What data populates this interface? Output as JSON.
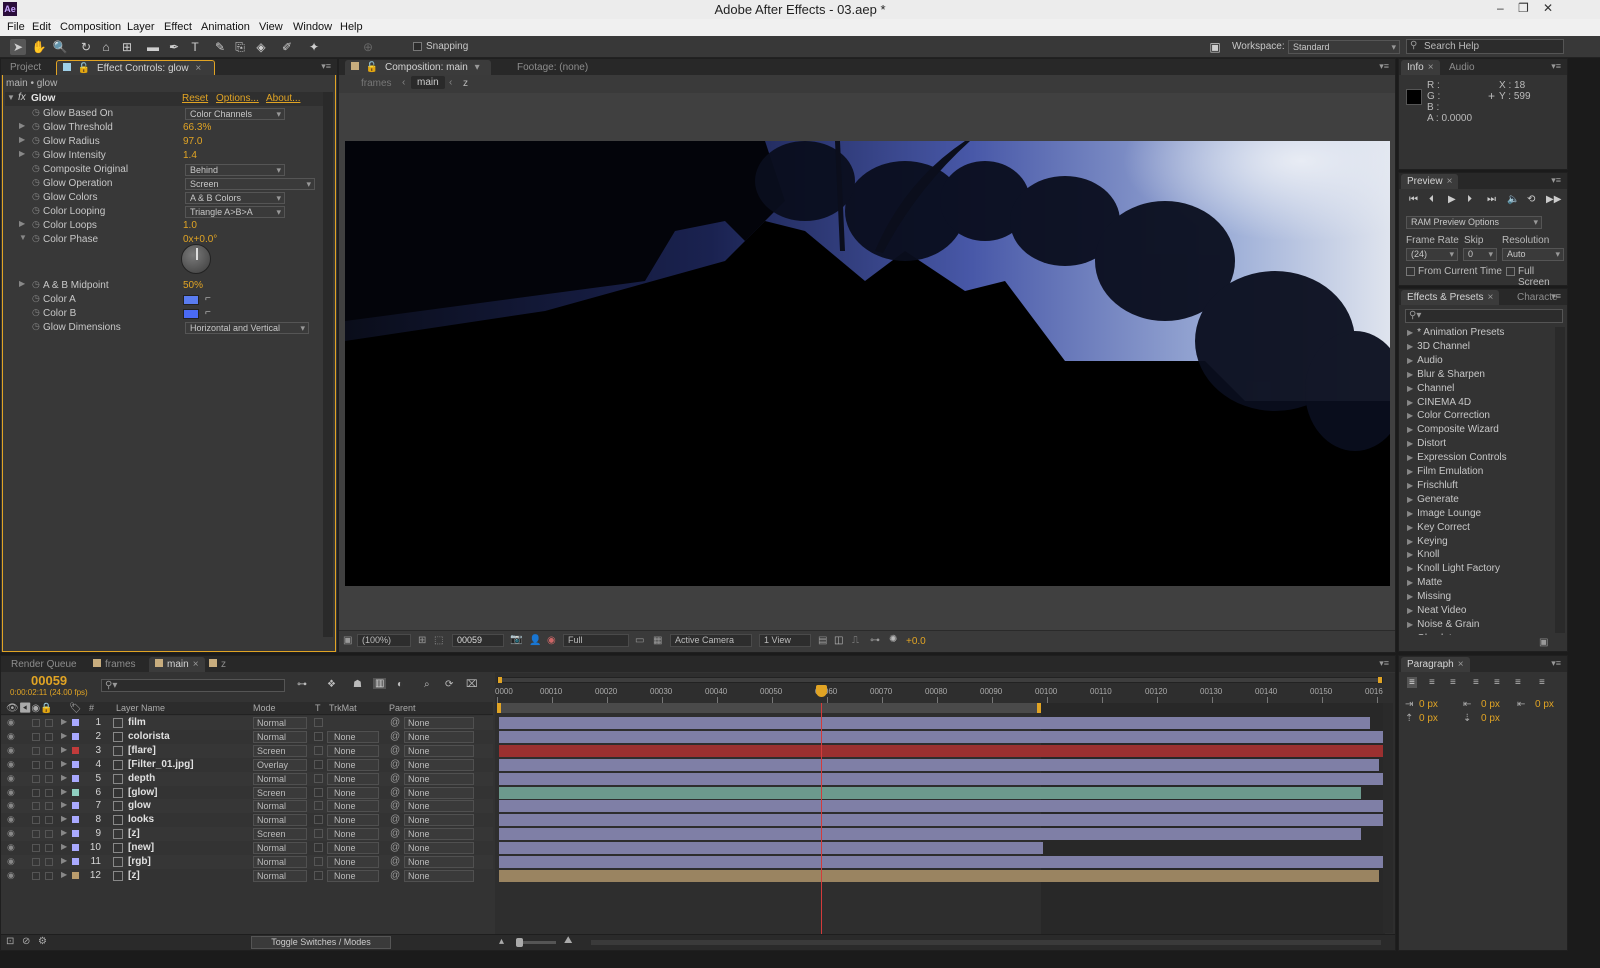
{
  "app": {
    "title": "Adobe After Effects - 03.aep *",
    "logo": "Ae"
  },
  "menu": [
    "File",
    "Edit",
    "Composition",
    "Layer",
    "Effect",
    "Animation",
    "View",
    "Window",
    "Help"
  ],
  "toolbar": {
    "snapping_label": "Snapping",
    "workspace_label": "Workspace:",
    "workspace_value": "Standard",
    "search_placeholder": "Search Help"
  },
  "effect_controls": {
    "tab_project": "Project",
    "tab_label": "Effect Controls: glow",
    "breadcrumb": "main • glow",
    "effect_name": "Glow",
    "links": {
      "reset": "Reset",
      "options": "Options...",
      "about": "About..."
    },
    "props": [
      {
        "label": "Glow Based On",
        "dropdown": "Color Channels"
      },
      {
        "label": "Glow Threshold",
        "value": "66.3%"
      },
      {
        "label": "Glow Radius",
        "value": "97.0"
      },
      {
        "label": "Glow Intensity",
        "value": "1.4"
      },
      {
        "label": "Composite Original",
        "dropdown": "Behind"
      },
      {
        "label": "Glow Operation",
        "dropdown": "Screen"
      },
      {
        "label": "Glow Colors",
        "dropdown": "A & B Colors"
      },
      {
        "label": "Color Looping",
        "dropdown": "Triangle A>B>A"
      },
      {
        "label": "Color Loops",
        "value": "1.0"
      },
      {
        "label": "Color Phase",
        "value": "0x+0.0°"
      },
      {
        "label": "A & B Midpoint",
        "value": "50%"
      },
      {
        "label": "Color A"
      },
      {
        "label": "Color B"
      },
      {
        "label": "Glow Dimensions",
        "dropdown": "Horizontal and Vertical"
      }
    ],
    "color_a": "#5a7cf0",
    "color_b": "#4a6af4"
  },
  "composition": {
    "tab_label": "Composition: main",
    "footage_tab": "Footage: (none)",
    "breadcrumbs": [
      "frames",
      "main",
      "z"
    ],
    "zoom": "(100%)",
    "timecode": "00059",
    "resolution": "Full",
    "camera": "Active Camera",
    "views": "1 View",
    "exposure": "+0.0"
  },
  "info": {
    "tab_info": "Info",
    "tab_audio": "Audio",
    "r": "R :",
    "g": "G :",
    "b": "B :",
    "a": "A :  0.0000",
    "x": "X : 18",
    "y": "Y : 599"
  },
  "preview": {
    "tab_label": "Preview",
    "ram_options": "RAM Preview Options",
    "frame_rate_label": "Frame Rate",
    "skip_label": "Skip",
    "resolution_label": "Resolution",
    "frame_rate": "(24)",
    "skip": "0",
    "resolution": "Auto",
    "from_current": "From Current Time",
    "full_screen": "Full Screen"
  },
  "effects_presets": {
    "tab_label": "Effects & Presets",
    "tab_character": "Characte",
    "items": [
      "* Animation Presets",
      "3D Channel",
      "Audio",
      "Blur & Sharpen",
      "Channel",
      "CINEMA 4D",
      "Color Correction",
      "Composite Wizard",
      "Distort",
      "Expression Controls",
      "Film Emulation",
      "Frischluft",
      "Generate",
      "Image Lounge",
      "Key Correct",
      "Keying",
      "Knoll",
      "Knoll Light Factory",
      "Matte",
      "Missing",
      "Neat Video",
      "Noise & Grain",
      "Obsolete"
    ]
  },
  "paragraph": {
    "tab_label": "Paragraph",
    "px": [
      "0 px",
      "0 px",
      "0 px",
      "0 px",
      "0 px"
    ]
  },
  "timeline": {
    "tabs": [
      "Render Queue",
      "frames",
      "main",
      "z"
    ],
    "timecode": "00059",
    "timecode_sub": "0:00:02:11 (24.00 fps)",
    "headers": {
      "layer_name": "Layer Name",
      "mode": "Mode",
      "t": "T",
      "trkmat": "TrkMat",
      "parent": "Parent",
      "hash": "#"
    },
    "ruler": [
      "0000",
      "00010",
      "00020",
      "00030",
      "00040",
      "00050",
      "00060",
      "00070",
      "00080",
      "00090",
      "00100",
      "00110",
      "00120",
      "00130",
      "00140",
      "00150",
      "0016"
    ],
    "toggle_label": "Toggle Switches / Modes",
    "layers": [
      {
        "num": "1",
        "name": "film",
        "mode": "Normal",
        "trk": "",
        "parent": "None",
        "label": "#a9a9ff",
        "bar": "#7f7fa6",
        "end": 0.985
      },
      {
        "num": "2",
        "name": "colorista",
        "mode": "Normal",
        "trk": "None",
        "parent": "None",
        "label": "#a9a9ff",
        "bar": "#7f7fa6",
        "end": 1.0
      },
      {
        "num": "3",
        "name": "[flare]",
        "mode": "Screen",
        "trk": "None",
        "parent": "None",
        "label": "#c13b3b",
        "bar": "#9b3030",
        "end": 1.0
      },
      {
        "num": "4",
        "name": "[Filter_01.jpg]",
        "mode": "Overlay",
        "trk": "None",
        "parent": "None",
        "label": "#a9a9ff",
        "bar": "#7f7fa6",
        "end": 0.995
      },
      {
        "num": "5",
        "name": "depth",
        "mode": "Normal",
        "trk": "None",
        "parent": "None",
        "label": "#a9a9ff",
        "bar": "#7f7fa6",
        "end": 1.0
      },
      {
        "num": "6",
        "name": "[glow]",
        "mode": "Screen",
        "trk": "None",
        "parent": "None",
        "label": "#8fcfc0",
        "bar": "#6c9a8d",
        "end": 0.975
      },
      {
        "num": "7",
        "name": "glow",
        "mode": "Normal",
        "trk": "None",
        "parent": "None",
        "label": "#a9a9ff",
        "bar": "#7f7fa6",
        "end": 1.0
      },
      {
        "num": "8",
        "name": "looks",
        "mode": "Normal",
        "trk": "None",
        "parent": "None",
        "label": "#a9a9ff",
        "bar": "#7f7fa6",
        "end": 1.0
      },
      {
        "num": "9",
        "name": "[z]",
        "mode": "Screen",
        "trk": "None",
        "parent": "None",
        "label": "#a9a9ff",
        "bar": "#7f7fa6",
        "end": 0.975
      },
      {
        "num": "10",
        "name": "[new]",
        "mode": "Normal",
        "trk": "None",
        "parent": "None",
        "label": "#a9a9ff",
        "bar": "#7f7fa6",
        "end": 0.615
      },
      {
        "num": "11",
        "name": "[rgb]",
        "mode": "Normal",
        "trk": "None",
        "parent": "None",
        "label": "#a9a9ff",
        "bar": "#7f7fa6",
        "end": 1.0
      },
      {
        "num": "12",
        "name": "[z]",
        "mode": "Normal",
        "trk": "None",
        "parent": "None",
        "label": "#b99b6c",
        "bar": "#9a8461",
        "end": 0.995
      }
    ]
  }
}
